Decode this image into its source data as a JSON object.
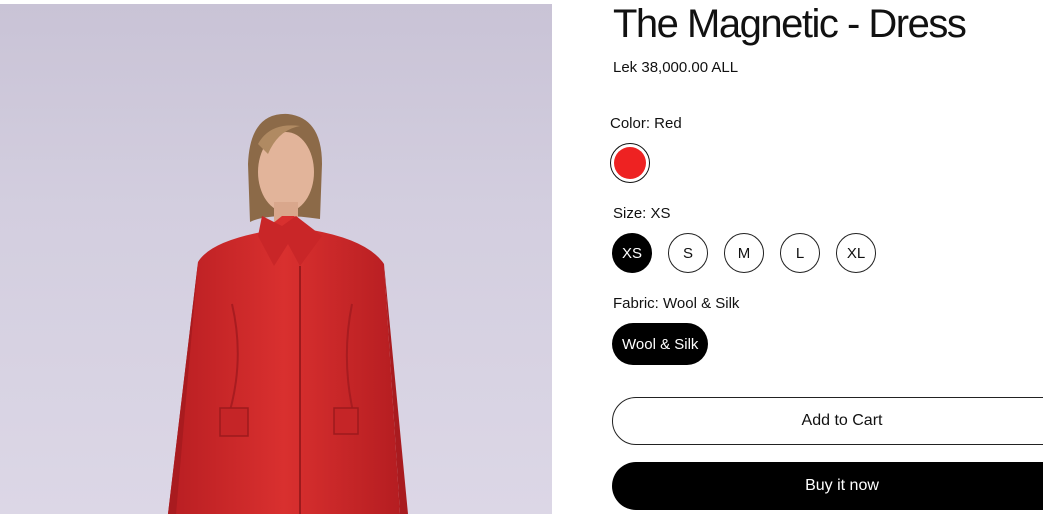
{
  "product": {
    "title": "The Magnetic - Dress",
    "price": "Lek 38,000.00 ALL"
  },
  "options": {
    "color": {
      "label": "Color: Red",
      "swatches": [
        {
          "name": "Red",
          "hex": "#ee2222",
          "selected": true
        }
      ]
    },
    "size": {
      "label": "Size: XS",
      "values": [
        "XS",
        "S",
        "M",
        "L",
        "XL"
      ],
      "selected": "XS"
    },
    "fabric": {
      "label": "Fabric: Wool & Silk",
      "values": [
        "Wool & Silk"
      ],
      "selected": "Wool & Silk"
    }
  },
  "actions": {
    "add_to_cart": "Add to Cart",
    "buy_now": "Buy it now"
  },
  "colors": {
    "accent": "#000000",
    "swatch_red": "#ee2222",
    "photo_background": "#d3cedf",
    "jacket": "#d42a2a"
  }
}
